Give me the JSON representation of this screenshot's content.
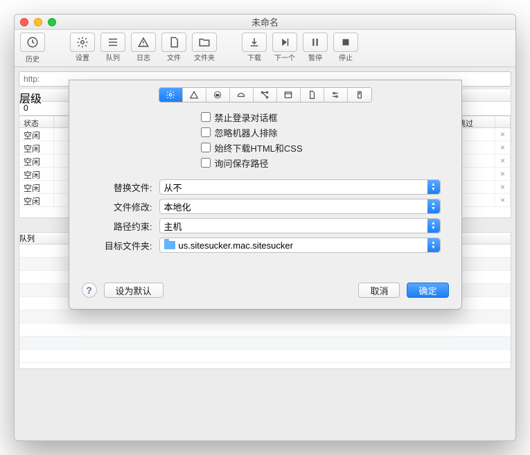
{
  "window": {
    "title": "未命名"
  },
  "toolbar": {
    "history": "历史",
    "settings": "设置",
    "queue": "队列",
    "log": "日志",
    "file": "文件",
    "folder": "文件夹",
    "download": "下载",
    "next": "下一个",
    "pause": "暂停",
    "stop": "停止"
  },
  "urlbar": {
    "placeholder": "http:"
  },
  "levels": {
    "header": "层级",
    "value": "0"
  },
  "statusTable": {
    "col_status": "状态",
    "col_skipped": "跳过",
    "rows": [
      {
        "status": "空闲",
        "url": ""
      },
      {
        "status": "空闲",
        "url": ""
      },
      {
        "status": "空闲",
        "url": ""
      },
      {
        "status": "空闲",
        "url": ""
      },
      {
        "status": "空闲",
        "url": ""
      },
      {
        "status": "空闲",
        "url": ""
      }
    ],
    "close_glyph": "×"
  },
  "queue": {
    "header": "队列"
  },
  "modal": {
    "checks": {
      "suppress_login": "禁止登录对话框",
      "ignore_robots": "忽略机器人排除",
      "always_html_css": "始终下载HTML和CSS",
      "ask_save_path": "询问保存路径"
    },
    "fields": {
      "replace_label": "替换文件:",
      "replace_value": "从不",
      "modify_label": "文件修改:",
      "modify_value": "本地化",
      "path_label": "路径约束:",
      "path_value": "主机",
      "dest_label": "目标文件夹:",
      "dest_value": "us.sitesucker.mac.sitesucker"
    },
    "buttons": {
      "help": "?",
      "set_default": "设为默认",
      "cancel": "取消",
      "ok": "确定"
    }
  }
}
